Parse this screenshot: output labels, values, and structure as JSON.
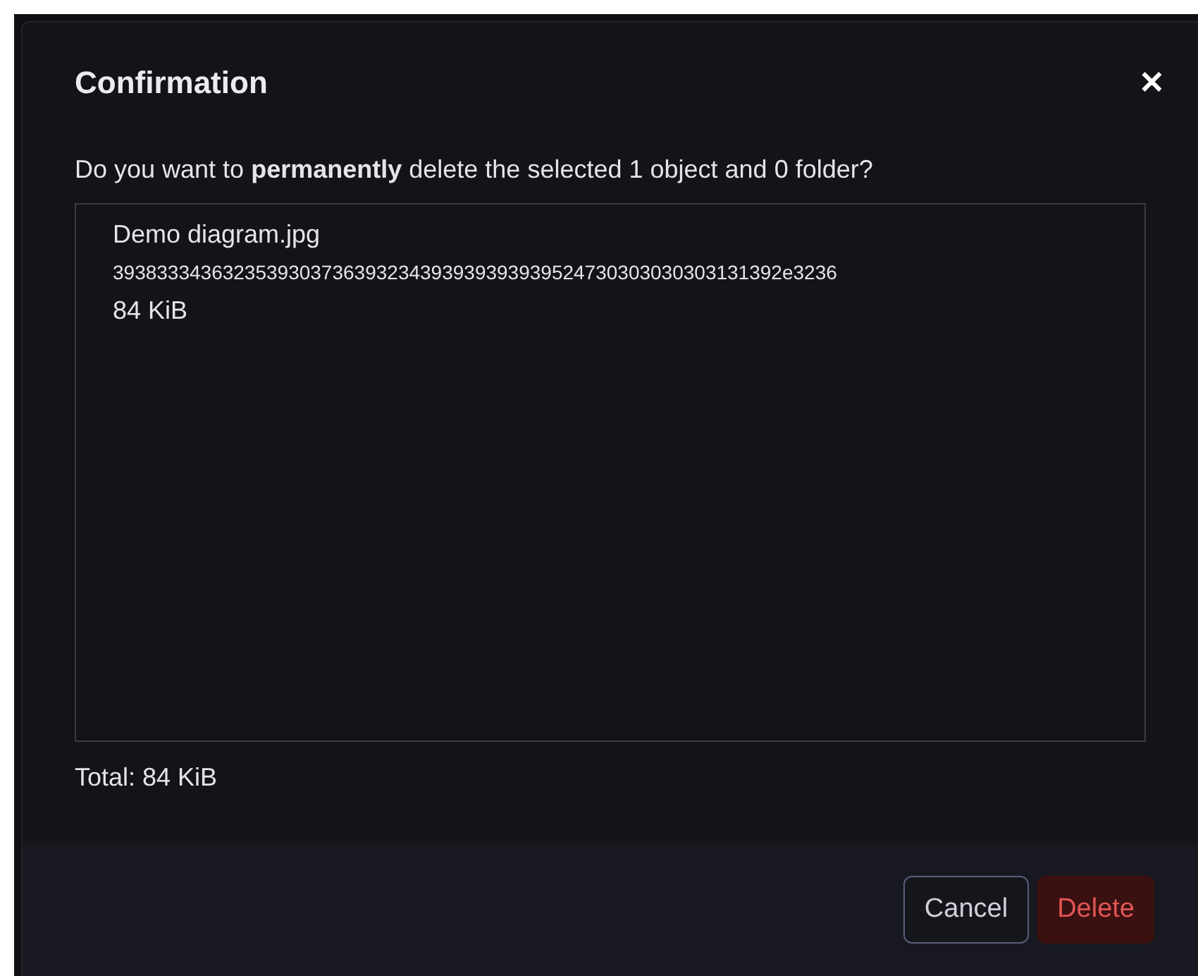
{
  "dialog": {
    "title": "Confirmation",
    "close": "✕",
    "message": "Do you want to **permanently** delete the selected 1 object and 0 folder?",
    "items": [
      {
        "name": "Demo diagram.jpg",
        "id": "3938333436323539303736393234393939393939524730303030303131392e3236",
        "size": "84 KiB"
      }
    ],
    "total": "Total: 84 KiB",
    "buttons": [
      {
        "label": "Cancel",
        "kind": "secondary"
      },
      {
        "label": "Delete",
        "kind": "danger"
      }
    ]
  }
}
